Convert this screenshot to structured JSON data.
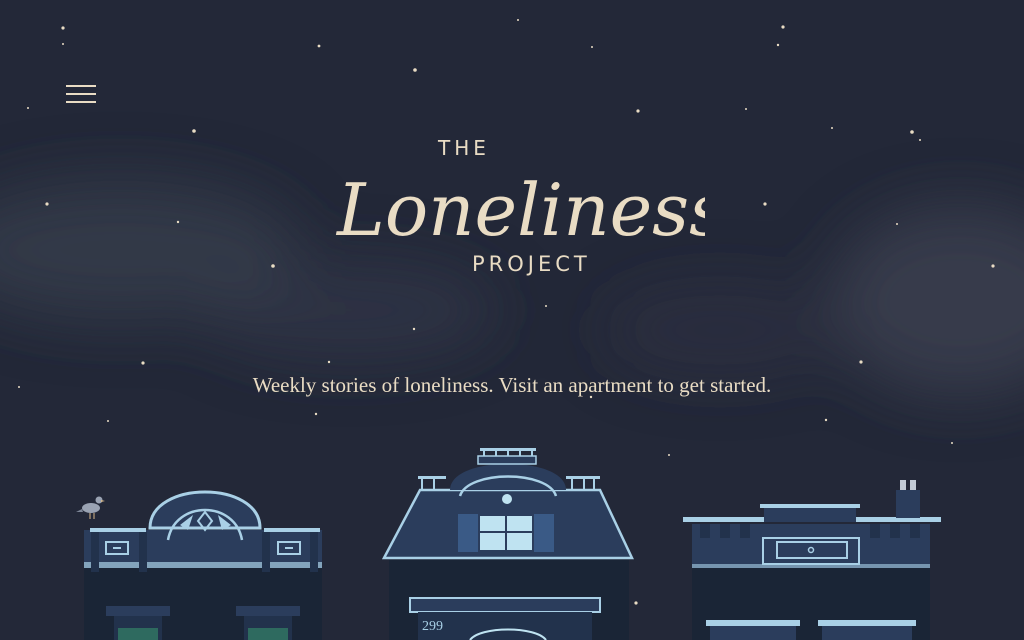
{
  "header": {
    "menu_icon": "hamburger-menu-icon"
  },
  "logo": {
    "the": "THE",
    "script": "Loneliness",
    "project": "PROJECT"
  },
  "tagline": "Weekly stories of loneliness. Visit an apartment to get started.",
  "buildings": {
    "center_number": "299"
  },
  "colors": {
    "sky": "#232838",
    "logo_text": "#e9dcc4",
    "building_dark": "#1a2536",
    "building_mid": "#2b3d5c",
    "trim": "#a9d0e6",
    "window_light": "#bfe3f1"
  }
}
